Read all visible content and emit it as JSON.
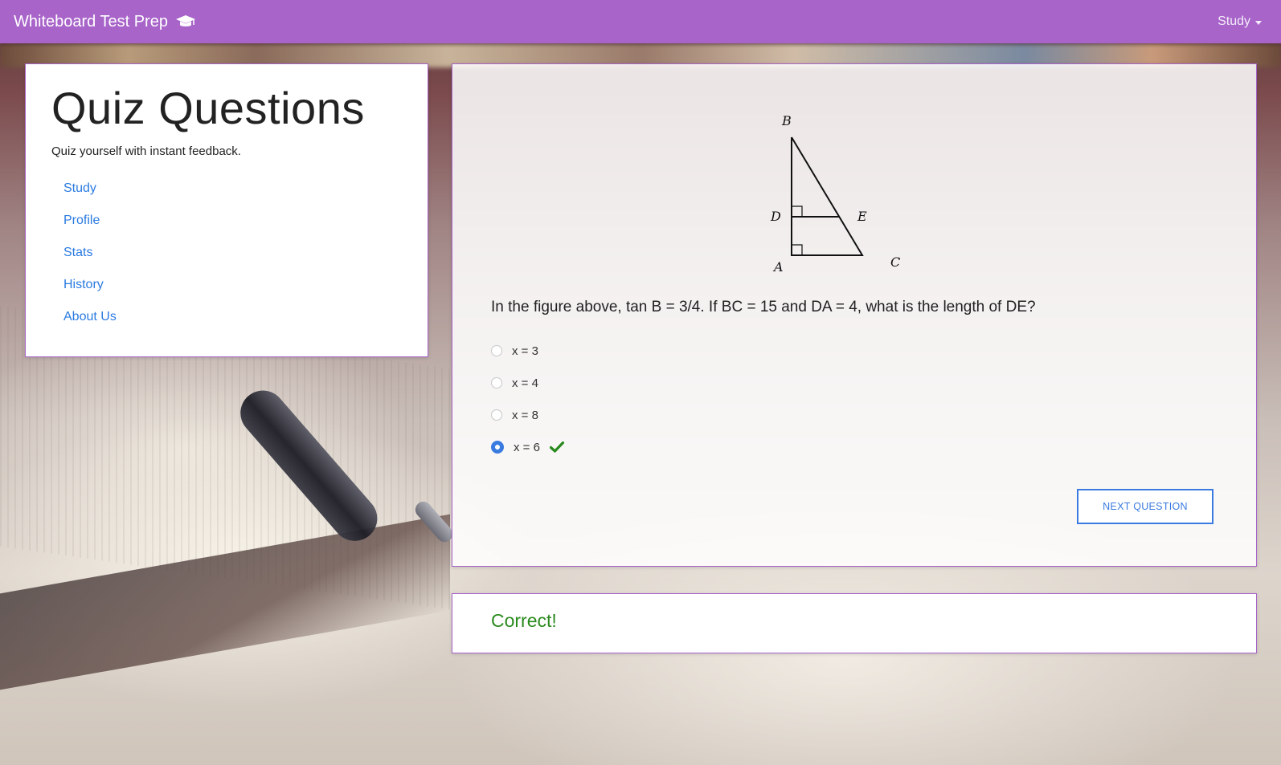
{
  "navbar": {
    "brand": "Whiteboard Test Prep",
    "brand_icon": "graduation-cap-icon",
    "dropdown_label": "Study",
    "background": "#a864c9"
  },
  "sidebar": {
    "title": "Quiz Questions",
    "subtitle": "Quiz yourself with instant feedback.",
    "links": [
      {
        "label": "Study"
      },
      {
        "label": "Profile"
      },
      {
        "label": "Stats"
      },
      {
        "label": "History"
      },
      {
        "label": "About Us"
      }
    ]
  },
  "quiz": {
    "figure": {
      "labels": {
        "b": "B",
        "d": "D",
        "e": "E",
        "a": "A",
        "c": "C"
      }
    },
    "question": "In the figure above, tan B = 3/4. If BC = 15 and DA = 4, what is the length of DE?",
    "answers": [
      {
        "label": "x = 3",
        "selected": false
      },
      {
        "label": "x = 4",
        "selected": false
      },
      {
        "label": "x = 8",
        "selected": false
      },
      {
        "label": "x = 6",
        "selected": true,
        "correct": true
      }
    ],
    "next_button": "NEXT QUESTION"
  },
  "feedback": {
    "text": "Correct!",
    "color": "#2a8a1e"
  },
  "colors": {
    "accent": "#a864c9",
    "link": "#2b7be0",
    "button": "#3a7be0"
  }
}
